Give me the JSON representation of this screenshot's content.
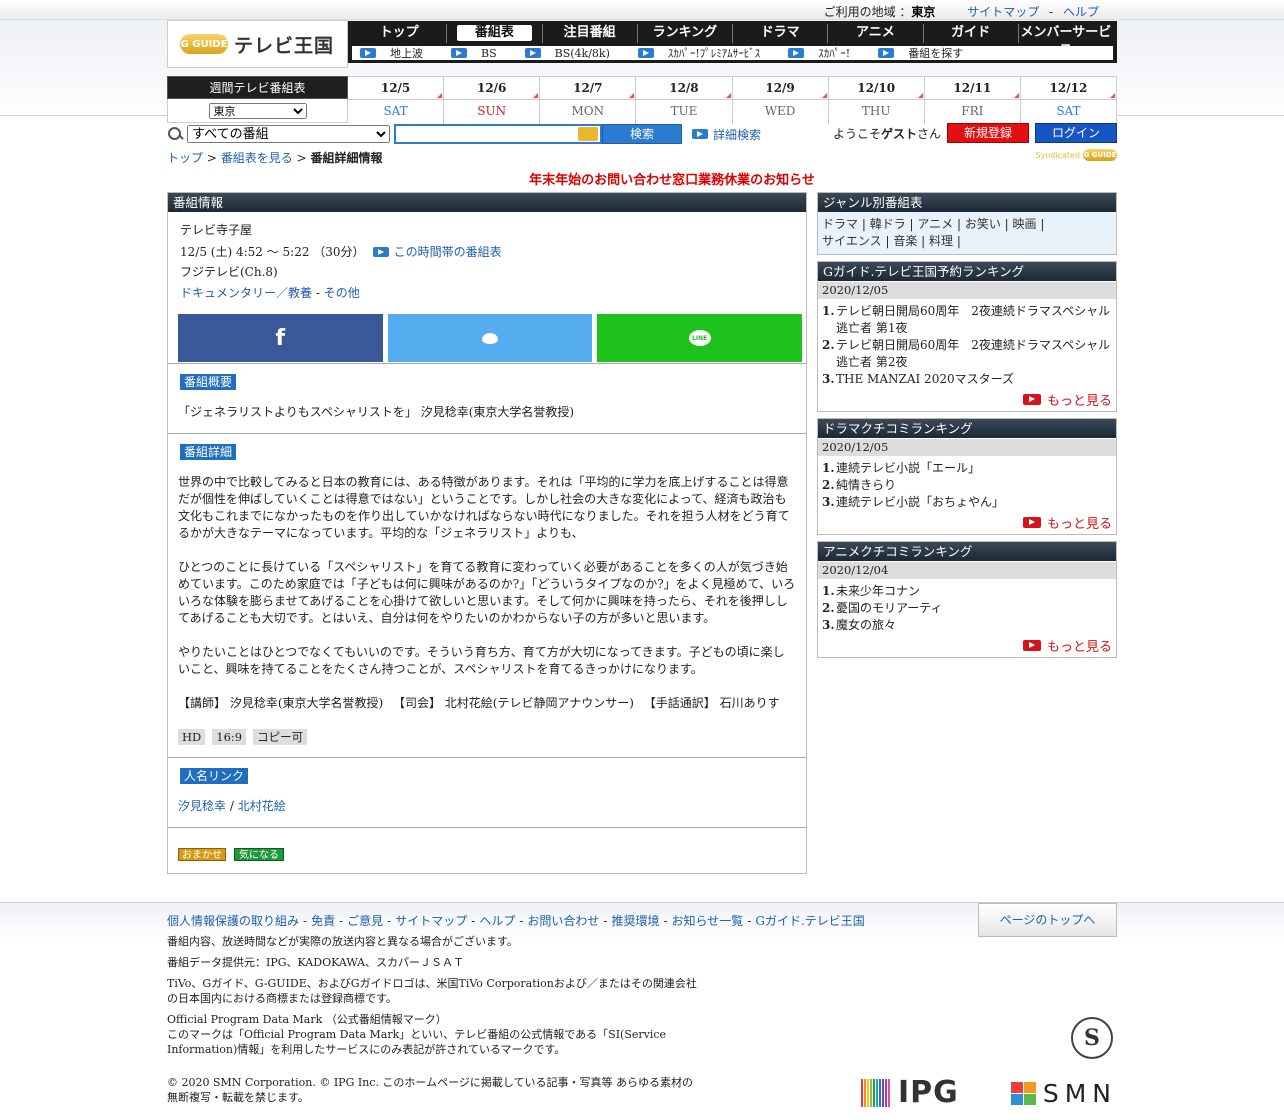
{
  "topbar": {
    "region_label": "ご利用の地域 ：",
    "region_value": "東京",
    "sitemap": "サイトマップ",
    "separator": "-",
    "help": "ヘルプ"
  },
  "logo": {
    "badge": "G GUIDE",
    "text": "テレビ王国"
  },
  "nav": {
    "main": [
      "トップ",
      "番組表",
      "注目番組",
      "ランキング",
      "ドラマ",
      "アニメ",
      "ガイド",
      "メンバーサービス"
    ],
    "active_index": 1,
    "sub": [
      "地上波",
      "BS",
      "BS(4k/8k)",
      "ｽｶﾊﾟｰ!ﾌﾟﾚﾐｱﾑｻｰﾋﾞｽ",
      "ｽｶﾊﾟｰ!",
      "番組を探す"
    ]
  },
  "week": {
    "label": "週間テレビ番組表",
    "area_select": "東京",
    "days": [
      {
        "date": "12/5",
        "dow": "SAT",
        "kind": "sat"
      },
      {
        "date": "12/6",
        "dow": "SUN",
        "kind": "sun"
      },
      {
        "date": "12/7",
        "dow": "MON",
        "kind": "weekday"
      },
      {
        "date": "12/8",
        "dow": "TUE",
        "kind": "weekday"
      },
      {
        "date": "12/9",
        "dow": "WED",
        "kind": "weekday"
      },
      {
        "date": "12/10",
        "dow": "THU",
        "kind": "weekday"
      },
      {
        "date": "12/11",
        "dow": "FRI",
        "kind": "weekday"
      },
      {
        "date": "12/12",
        "dow": "SAT",
        "kind": "sat"
      }
    ]
  },
  "search": {
    "category_select": "すべての番組",
    "button": "検索",
    "advanced": "詳細検索"
  },
  "user": {
    "welcome_pre": "ようこそ",
    "welcome_name": "ゲスト",
    "welcome_post": "さん",
    "register": "新規登録",
    "login": "ログイン"
  },
  "breadcrumb": {
    "top": "トップ",
    "sep": ">",
    "schedule": "番組表を見る",
    "current": "番組詳細情報"
  },
  "syndicated": "Syndicated",
  "notice": "年末年始のお問い合わせ窓口業務休業のお知らせ",
  "program": {
    "section_title": "番組情報",
    "title": "テレビ寺子屋",
    "time": "12/5 (土) 4:52 ～ 5:22 （30分）",
    "time_link": "この時間帯の番組表",
    "channel": "フジテレビ(Ch.8)",
    "genre_main": "ドキュメンタリー／教養",
    "genre_sep": " - ",
    "genre_sub": "その他",
    "summary_tag": "番組概要",
    "summary": "「ジェネラリストよりもスペシャリストを」 汐見稔幸(東京大学名誉教授)",
    "detail_tag": "番組詳細",
    "detail": [
      "世界の中で比較してみると日本の教育には、ある特徴があります。それは「平均的に学力を底上げすることは得意だが個性を伸ばしていくことは得意ではない」ということです。しかし社会の大きな変化によって、経済も政治も文化もこれまでになかったものを作り出していかなければならない時代になりました。それを担う人材をどう育てるかが大きなテーマになっています。平均的な「ジェネラリスト」よりも、",
      "ひとつのことに長けている「スペシャリスト」を育てる教育に変わっていく必要があることを多くの人が気づき始めています。このため家庭では「子どもは何に興味があるのか?」「どういうタイプなのか?」をよく見極めて、いろいろな体験を膨らませてあげることを心掛けて欲しいと思います。そして何かに興味を持ったら、それを後押ししてあげることも大切です。とはいえ、自分は何をやりたいのかわからない子の方が多いと思います。",
      "やりたいことはひとつでなくてもいいのです。そういう育ち方、育て方が大切になってきます。子どもの頃に楽しいこと、興味を持てることをたくさん持つことが、スペシャリストを育てるきっかけになります。",
      "【講師】 汐見稔幸(東京大学名誉教授) 　【司会】 北村花絵(テレビ静岡アナウンサー) 　【手話通訳】 石川ありす"
    ],
    "badges": [
      "HD",
      "16:9",
      "コピー可"
    ],
    "people_tag": "人名リンク",
    "people": [
      "汐見稔幸",
      "北村花絵"
    ],
    "people_sep": " / ",
    "btn_omakase": "おまかせ",
    "btn_kininaru": "気になる"
  },
  "sidebar": {
    "genre": {
      "title": "ジャンル別番組表",
      "items": [
        "ドラマ",
        "韓ドラ",
        "アニメ",
        "お笑い",
        "映画",
        "サイエンス",
        "音楽",
        "料理"
      ]
    },
    "rankings": [
      {
        "title": "Gガイド.テレビ王国予約ランキング",
        "date": "2020/12/05",
        "items": [
          "テレビ朝日開局60周年　2夜連続ドラマスペシャル　逃亡者 第1夜",
          "テレビ朝日開局60周年　2夜連続ドラマスペシャル　逃亡者 第2夜",
          "THE MANZAI 2020マスターズ"
        ],
        "more": "もっと見る"
      },
      {
        "title": "ドラマクチコミランキング",
        "date": "2020/12/05",
        "items": [
          "連続テレビ小説「エール」",
          "純情きらり",
          "連続テレビ小説「おちょやん」"
        ],
        "more": "もっと見る"
      },
      {
        "title": "アニメクチコミランキング",
        "date": "2020/12/04",
        "items": [
          "未来少年コナン",
          "憂国のモリアーティ",
          "魔女の旅々"
        ],
        "more": "もっと見る"
      }
    ]
  },
  "footer": {
    "links": [
      "個人情報保護の取り組み",
      "免責",
      "ご意見",
      "サイトマップ",
      "ヘルプ",
      "お問い合わせ",
      "推奨環境",
      "お知らせ一覧",
      "Gガイド.テレビ王国"
    ],
    "totop": "ページのトップへ",
    "disclaimer": "番組内容、放送時間などが実際の放送内容と異なる場合がございます。",
    "provider": "番組データ提供元：IPG、KADOKAWA、スカパーＪＳＡＴ",
    "trademark": "TiVo、Gガイド、G-GUIDE、およびGガイドロゴは、米国TiVo Corporationおよび／またはその関連会社の日本国内における商標または登録商標です。",
    "opdm_title": "Official Program Data Mark （公式番組情報マーク）",
    "opdm_text": "このマークは「Official Program Data Mark」といい、テレビ番組の公式情報である「SI(Service Information)情報」を利用したサービスにのみ表記が許されているマークです。",
    "copyright": "© 2020 SMN Corporation. © IPG Inc. このホームページに掲載している記事・写真等 あらゆる素材の無断複写・転載を禁じます。",
    "seal_letter": "S",
    "ipg_logo": "IPG",
    "smn_logo": "SMN"
  }
}
